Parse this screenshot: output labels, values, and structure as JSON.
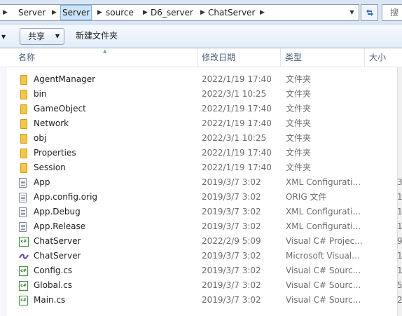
{
  "breadcrumb": {
    "items": [
      "Server",
      "Server",
      "source",
      "D6_server",
      "ChatServer"
    ]
  },
  "search": {
    "placeholder": "搜"
  },
  "toolbar": {
    "share_label": "共享",
    "new_folder_label": "新建文件夹"
  },
  "columns": {
    "name": "名称",
    "date": "修改日期",
    "type": "类型",
    "size": "大小"
  },
  "files": [
    {
      "name": "AgentManager",
      "date": "2022/1/19 17:40",
      "type": "文件夹",
      "size": "",
      "icon": "folder-icon"
    },
    {
      "name": "bin",
      "date": "2022/3/1 10:25",
      "type": "文件夹",
      "size": "",
      "icon": "folder-icon"
    },
    {
      "name": "GameObject",
      "date": "2022/1/19 17:40",
      "type": "文件夹",
      "size": "",
      "icon": "folder-icon"
    },
    {
      "name": "Network",
      "date": "2022/1/19 17:40",
      "type": "文件夹",
      "size": "",
      "icon": "folder-icon"
    },
    {
      "name": "obj",
      "date": "2022/3/1 10:25",
      "type": "文件夹",
      "size": "",
      "icon": "folder-icon"
    },
    {
      "name": "Properties",
      "date": "2022/1/19 17:40",
      "type": "文件夹",
      "size": "",
      "icon": "folder-icon"
    },
    {
      "name": "Session",
      "date": "2022/1/19 17:40",
      "type": "文件夹",
      "size": "",
      "icon": "folder-icon"
    },
    {
      "name": "App",
      "date": "2019/3/7 3:02",
      "type": "XML Configurati...",
      "size": "3",
      "icon": "config-file-icon"
    },
    {
      "name": "App.config.orig",
      "date": "2019/3/7 3:02",
      "type": "ORIG 文件",
      "size": "1",
      "icon": "file-icon"
    },
    {
      "name": "App.Debug",
      "date": "2019/3/7 3:02",
      "type": "XML Configurati...",
      "size": "1",
      "icon": "config-file-icon"
    },
    {
      "name": "App.Release",
      "date": "2019/3/7 3:02",
      "type": "XML Configurati...",
      "size": "1",
      "icon": "config-file-icon"
    },
    {
      "name": "ChatServer",
      "date": "2022/2/9 5:09",
      "type": "Visual C# Projec...",
      "size": "9",
      "icon": "csproj-icon"
    },
    {
      "name": "ChatServer",
      "date": "2019/3/7 3:02",
      "type": "Microsoft Visual...",
      "size": "1",
      "icon": "solution-icon"
    },
    {
      "name": "Config.cs",
      "date": "2019/3/7 3:02",
      "type": "Visual C# Sourc...",
      "size": "1",
      "icon": "csharp-file-icon"
    },
    {
      "name": "Global.cs",
      "date": "2019/3/7 3:02",
      "type": "Visual C# Sourc...",
      "size": "5",
      "icon": "csharp-file-icon"
    },
    {
      "name": "Main.cs",
      "date": "2019/3/7 3:02",
      "type": "Visual C# Sourc...",
      "size": "2",
      "icon": "csharp-file-icon"
    }
  ]
}
